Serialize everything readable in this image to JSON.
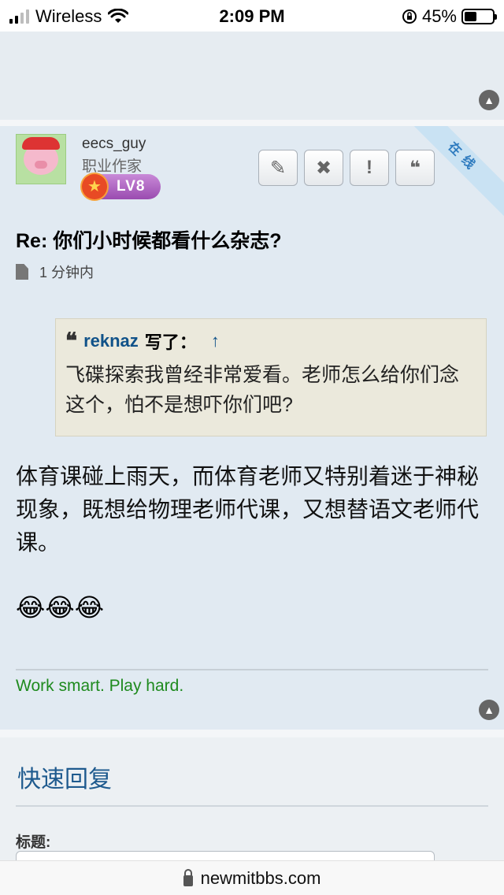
{
  "status_bar": {
    "carrier": "Wireless",
    "time": "2:09 PM",
    "battery_percent": "45%",
    "battery_level": 0.45,
    "icons": [
      "signal-bars-icon",
      "wifi-icon",
      "orientation-lock-icon",
      "battery-icon"
    ]
  },
  "post": {
    "username": "eecs_guy",
    "user_title": "职业作家",
    "rank_badge": "LV8",
    "online_ribbon": "在线",
    "actions": [
      {
        "name": "edit",
        "icon": "pencil-icon",
        "glyph": "✎"
      },
      {
        "name": "delete",
        "icon": "close-icon",
        "glyph": "✖"
      },
      {
        "name": "report",
        "icon": "exclamation-icon",
        "glyph": "!"
      },
      {
        "name": "quote",
        "icon": "quote-icon",
        "glyph": "❝"
      }
    ],
    "title": "Re: 你们小时候都看什么杂志?",
    "time_ago": "1 分钟内",
    "quote": {
      "author": "reknaz",
      "wrote": "写了：",
      "arrow": "↑",
      "text": "飞碟探索我曾经非常爱看。老师怎么给你们念这个，怕不是想吓你们吧?"
    },
    "body": "体育课碰上雨天，而体育老师又特别着迷于神秘现象，既想给物理老师代课，又想替语文老师代课。",
    "emoji": "😂😂😂",
    "signature": "Work smart. Play hard."
  },
  "quick_reply": {
    "title": "快速回复",
    "subject_label": "标题:",
    "subject_value": ""
  },
  "url_bar": {
    "domain": "newmitbbs.com"
  },
  "colors": {
    "link_blue": "#105289",
    "signature_green": "#1e8a1e",
    "post_bg": "#e1eaf2",
    "quote_bg": "#ebe9dc"
  }
}
